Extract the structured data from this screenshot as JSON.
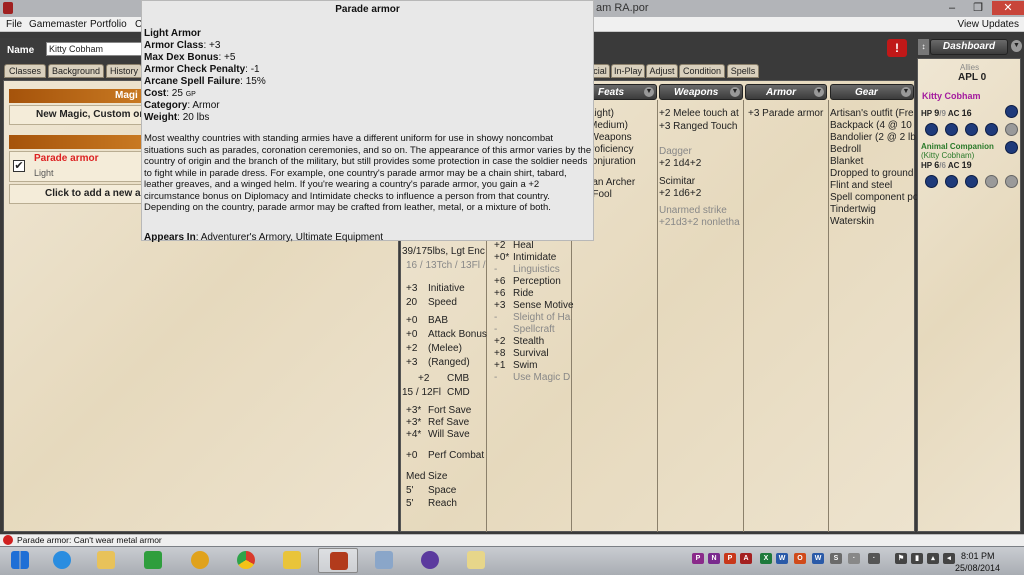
{
  "window": {
    "title_fragment": "am RA.por",
    "min": "–",
    "max": "❐",
    "close": "✕"
  },
  "menu": {
    "items": [
      "File",
      "Gamemaster",
      "Portfolio",
      "C"
    ],
    "right": "View Updates"
  },
  "character": {
    "name_label": "Name",
    "name_value": "Kitty Cobham"
  },
  "tabs_left": [
    "Classes",
    "Background",
    "History"
  ],
  "tabs_right": [
    "cial",
    "In-Play",
    "Adjust",
    "Condition",
    "Spells"
  ],
  "magic_panel": {
    "header": "Magi",
    "new_magic": "New Magic, Custom or",
    "armor_name": "Parade armor",
    "armor_type": "Light",
    "check": "✔",
    "add_new": "Click to add a new a"
  },
  "tooltip": {
    "title": "Parade armor",
    "type": "Light Armor",
    "armor_class_label": "Armor Class",
    "armor_class": ": +3",
    "max_dex_label": "Max Dex Bonus",
    "max_dex": ": +5",
    "check_penalty_label": "Armor Check Penalty",
    "check_penalty": ": -1",
    "spell_failure_label": "Arcane Spell Failure",
    "spell_failure": ": 15%",
    "cost_label": "Cost",
    "cost": ": 25",
    "cost_unit": "GP",
    "category_label": "Category",
    "category": ": Armor",
    "weight_label": "Weight",
    "weight": ": 20 lbs",
    "description": "Most wealthy countries with standing armies have a different uniform for use in showy noncombat situations such as parades, coronation ceremonies, and so on. The appearance of this armor varies by the country of origin and the branch of the military, but still provides some protection in case the soldier needs to fight while in parade dress. For example, one country's parade armor may be a chain shirt, tabard, leather greaves, and a winged helm. If you're wearing a country's parade armor, you gain a +2 circumstance bonus on Diplomacy and Intimidate checks to influence a person from that country. Depending on the country, parade armor may be crafted from leather, metal, or a mixture of both.",
    "appears_label": "Appears In",
    "appears": ": Adventurer's Armory, Ultimate Equipment"
  },
  "sections": {
    "feats": "Feats",
    "weapons": "Weapons",
    "armor": "Armor",
    "gear": "Gear",
    "dropdown": "▼"
  },
  "stats": {
    "encumbrance": "39/175lbs,   Lgt Enc",
    "touch": "16 / 13Tch / 13Fl /",
    "rows": [
      {
        "val": "+3",
        "label": "Initiative"
      },
      {
        "val": "20",
        "label": "Speed"
      },
      {
        "val": "+0",
        "label": "BAB"
      },
      {
        "val": "+0",
        "label": "Attack Bonus"
      },
      {
        "val": "+2",
        "label": "(Melee)"
      },
      {
        "val": "+3",
        "label": "(Ranged)"
      },
      {
        "val": "+2",
        "label": "CMB"
      },
      {
        "val": "15 / 12Fl",
        "label": "CMD"
      },
      {
        "val": "+3*",
        "label": "Fort Save"
      },
      {
        "val": "+3*",
        "label": "Ref Save"
      },
      {
        "val": "+4*",
        "label": "Will Save"
      },
      {
        "val": "+0",
        "label": "Perf Combat"
      },
      {
        "val": "Med",
        "label": "Size"
      },
      {
        "val": "5'",
        "label": "Space"
      },
      {
        "val": "5'",
        "label": "Reach"
      }
    ]
  },
  "skills": [
    {
      "val": "+2",
      "label": "Heal",
      "dim": false
    },
    {
      "val": "+0*",
      "label": "Intimidate",
      "dim": false
    },
    {
      "val": "-",
      "label": "Linguistics",
      "dim": true
    },
    {
      "val": "+6",
      "label": "Perception",
      "dim": false
    },
    {
      "val": "+6",
      "label": "Ride",
      "dim": false
    },
    {
      "val": "+3",
      "label": "Sense Motive",
      "dim": false
    },
    {
      "val": "-",
      "label": "Sleight of Ha",
      "dim": true
    },
    {
      "val": "-",
      "label": "Spellcraft",
      "dim": true
    },
    {
      "val": "+2",
      "label": "Stealth",
      "dim": false
    },
    {
      "val": "+8",
      "label": "Survival",
      "dim": false
    },
    {
      "val": "+1",
      "label": "Swim",
      "dim": false
    },
    {
      "val": "-",
      "label": "Use Magic D",
      "dim": true
    }
  ],
  "feats": [
    "or (Light)",
    "or (Medium)",
    "dic Weapons",
    "ld Proficiency",
    "s: Conjuration",
    "zonian Archer",
    "ly a Fool"
  ],
  "weapons": {
    "lines": [
      {
        "text": "+2  Melee touch at",
        "dim": false
      },
      {
        "text": "+3  Ranged Touch",
        "dim": false
      },
      {
        "text": "Dagger",
        "dim": true
      },
      {
        "text": "  +2  1d4+2",
        "dim": false
      },
      {
        "text": "Scimitar",
        "dim": false
      },
      {
        "text": "  +2  1d6+2",
        "dim": false
      },
      {
        "text": "Unarmed strike",
        "dim": true
      },
      {
        "text": "  +21d3+2 nonletha",
        "dim": true
      }
    ]
  },
  "armor_list": {
    "line": "+3   Parade armor"
  },
  "gear_list": [
    "Artisan's outfit (Fre",
    "Backpack (4 @ 10",
    "Bandolier (2 @ 2 lb",
    "Bedroll",
    "Blanket",
    "Dropped to ground",
    "Flint and steel",
    "Spell component po",
    "Tindertwig",
    "Waterskin"
  ],
  "dashboard": {
    "button": "Dashboard",
    "allies_label": "Allies",
    "apl": "APL 0",
    "char1_name": "Kitty Cobham",
    "char1_hp_label": "HP",
    "char1_hp": "9",
    "char1_hp_max": "/9",
    "char1_ac_label": "AC",
    "char1_ac": "16",
    "char2_name": "Animal Companion",
    "char2_sub": "(Kitty Cobham)",
    "char2_hp_label": "HP",
    "char2_hp": "6",
    "char2_hp_max": "/6",
    "char2_ac_label": "AC",
    "char2_ac": "19"
  },
  "status": {
    "text": "Parade armor: Can't wear metal armor"
  },
  "clock": {
    "time": "8:01 PM",
    "date": "25/08/2014"
  },
  "colors": {
    "accent_orange": "#c46f1b",
    "alert_red": "#c01818",
    "ally_purple": "#a31a9e",
    "ally_green": "#2a7a2a"
  }
}
